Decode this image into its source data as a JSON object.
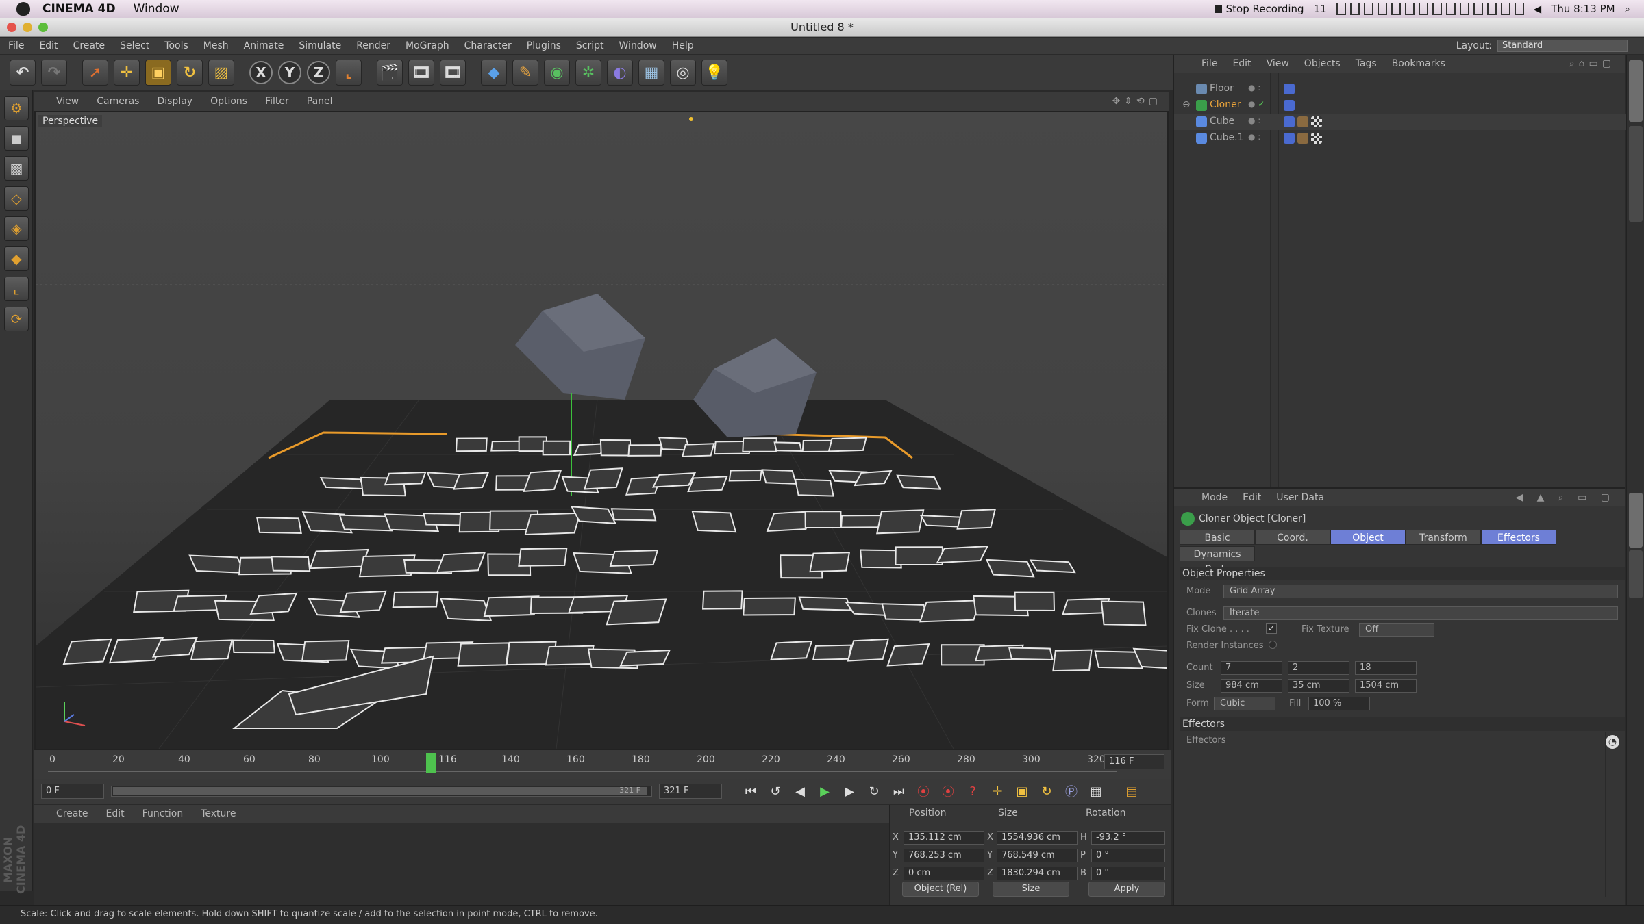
{
  "mac": {
    "app_name": "CINEMA 4D",
    "window_menu": "Window",
    "recording": "Stop Recording",
    "ai_badge": "11",
    "clock": "Thu 8:13 PM"
  },
  "window": {
    "title": "Untitled 8 *"
  },
  "menu": {
    "items": [
      "File",
      "Edit",
      "Create",
      "Select",
      "Tools",
      "Mesh",
      "Animate",
      "Simulate",
      "Render",
      "MoGraph",
      "Character",
      "Plugins",
      "Script",
      "Window",
      "Help"
    ],
    "layout_label": "Layout:",
    "layout_value": "Standard"
  },
  "viewport": {
    "menu": [
      "View",
      "Cameras",
      "Display",
      "Options",
      "Filter",
      "Panel"
    ],
    "label": "Perspective"
  },
  "timeline": {
    "ticks": [
      "0",
      "20",
      "40",
      "60",
      "80",
      "100",
      "116",
      "140",
      "160",
      "180",
      "200",
      "220",
      "240",
      "260",
      "280",
      "300",
      "320"
    ],
    "current_frame": "116 F",
    "start_field": "0 F",
    "end_field": "321 F",
    "range_end": "321 F"
  },
  "material_manager": {
    "menu": [
      "Create",
      "Edit",
      "Function",
      "Texture"
    ]
  },
  "coord_manager": {
    "headers": {
      "position": "Position",
      "size": "Size",
      "rotation": "Rotation"
    },
    "rows": [
      {
        "axis": "X",
        "pos": "135.112 cm",
        "size_axis": "X",
        "size": "1554.936 cm",
        "rot_axis": "H",
        "rot": "-93.2 °"
      },
      {
        "axis": "Y",
        "pos": "768.253 cm",
        "size_axis": "Y",
        "size": "768.549 cm",
        "rot_axis": "P",
        "rot": "0 °"
      },
      {
        "axis": "Z",
        "pos": "0 cm",
        "size_axis": "Z",
        "size": "1830.294 cm",
        "rot_axis": "B",
        "rot": "0 °"
      }
    ],
    "mode": "Object (Rel)",
    "size_mode": "Size",
    "apply": "Apply"
  },
  "object_manager": {
    "menu": [
      "File",
      "Edit",
      "View",
      "Objects",
      "Tags",
      "Bookmarks"
    ],
    "objects": [
      {
        "name": "Floor"
      },
      {
        "name": "Cloner"
      },
      {
        "name": "Cube"
      },
      {
        "name": "Cube.1"
      }
    ]
  },
  "attribute_manager": {
    "menu": [
      "Mode",
      "Edit",
      "User Data"
    ],
    "title": "Cloner Object [Cloner]",
    "tabs": [
      "Basic",
      "Coord.",
      "Object",
      "Transform",
      "Effectors"
    ],
    "tab2": "Dynamics Body",
    "section_object": "Object Properties",
    "mode_label": "Mode",
    "mode_value": "Grid Array",
    "clones_label": "Clones",
    "clones_value": "Iterate",
    "fix_clone_label": "Fix Clone . . . .",
    "fix_texture_label": "Fix Texture",
    "fix_texture_value": "Off",
    "render_instances_label": "Render Instances",
    "count_label": "Count",
    "count": [
      "7",
      "2",
      "18"
    ],
    "size_label": "Size",
    "size": [
      "984 cm",
      "35 cm",
      "1504 cm"
    ],
    "form_label": "Form",
    "form_value": "Cubic",
    "fill_label": "Fill",
    "fill_value": "100 %",
    "section_effectors": "Effectors",
    "effectors_label": "Effectors"
  },
  "status": "Scale: Click and drag to scale elements. Hold down SHIFT to quantize scale / add to the selection in point mode, CTRL to remove.",
  "brand": "MAXON CINEMA 4D",
  "colors": {
    "accent_tab": "#6e7fd6",
    "timeline_marker": "#4ec24e",
    "selection_orange": "#e89a2a"
  }
}
